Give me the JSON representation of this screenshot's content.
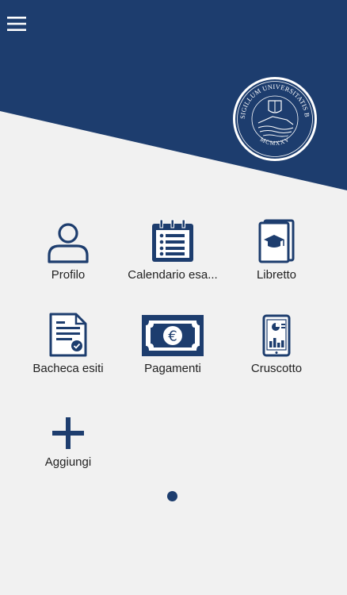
{
  "theme": {
    "primary": "#1d3d6e",
    "background": "#f1f1f1",
    "text": "#222222"
  },
  "header": {
    "menu_icon": "hamburger-menu-icon",
    "seal_text_top": "SIGILLUM UNIVERSITATIS BARENSIS",
    "seal_text_bottom": "MCMXXV"
  },
  "tiles": [
    {
      "label": "Profilo",
      "icon": "user-icon"
    },
    {
      "label": "Calendario esa...",
      "icon": "calendar-list-icon"
    },
    {
      "label": "Libretto",
      "icon": "graduation-book-icon"
    },
    {
      "label": "Bacheca esiti",
      "icon": "certificate-document-icon"
    },
    {
      "label": "Pagamenti",
      "icon": "euro-banknote-icon"
    },
    {
      "label": "Cruscotto",
      "icon": "dashboard-tablet-icon"
    },
    {
      "label": "Aggiungi",
      "icon": "plus-icon"
    }
  ],
  "pagination": {
    "pages": 1,
    "current": 1
  }
}
